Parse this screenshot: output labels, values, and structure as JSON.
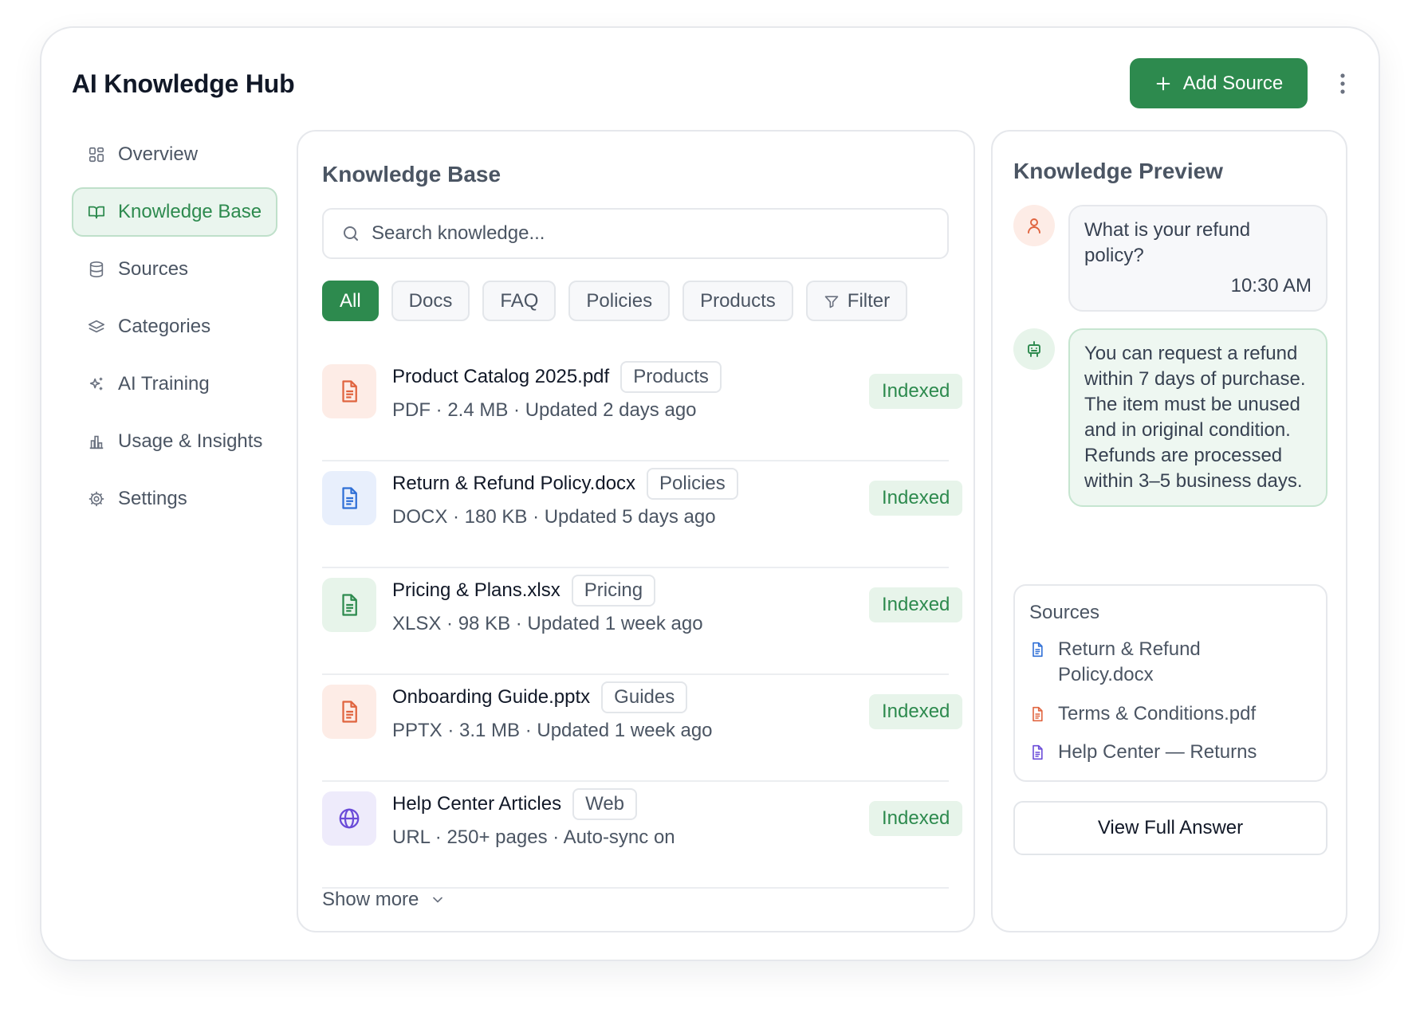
{
  "app": {
    "title": "AI Knowledge Hub"
  },
  "header": {
    "add_source_label": "Add Source",
    "accent": "#2d8a4e"
  },
  "sidebar": {
    "items": [
      {
        "label": "Overview",
        "icon": "grid-icon",
        "active": false
      },
      {
        "label": "Knowledge Base",
        "icon": "book-icon",
        "active": true
      },
      {
        "label": "Sources",
        "icon": "database-icon",
        "active": false
      },
      {
        "label": "Categories",
        "icon": "layers-icon",
        "active": false
      },
      {
        "label": "AI Training",
        "icon": "sparkles-icon",
        "active": false
      },
      {
        "label": "Usage & Insights",
        "icon": "bar-chart-icon",
        "active": false
      },
      {
        "label": "Settings",
        "icon": "gear-icon",
        "active": false
      }
    ]
  },
  "knowledge_base": {
    "title": "Knowledge Base",
    "search": {
      "placeholder": "Search knowledge...",
      "value": ""
    },
    "filters": [
      {
        "label": "All",
        "active": true
      },
      {
        "label": "Docs",
        "active": false
      },
      {
        "label": "FAQ",
        "active": false
      },
      {
        "label": "Policies",
        "active": false
      },
      {
        "label": "Products",
        "active": false
      },
      {
        "label": "Filter",
        "active": false
      }
    ],
    "items": [
      {
        "name": "Product Catalog 2025.pdf",
        "tag": "Products",
        "meta": "PDF · 2.4 MB · Updated 2 days ago",
        "status": "Indexed",
        "icon": "pdf-file-icon",
        "icon_color": "#e0643f",
        "icon_bg": "#fdece6"
      },
      {
        "name": "Return & Refund Policy.docx",
        "tag": "Policies",
        "meta": "DOCX · 180 KB · Updated 5 days ago",
        "status": "Indexed",
        "icon": "doc-file-icon",
        "icon_color": "#2f6fd6",
        "icon_bg": "#e8effc"
      },
      {
        "name": "Pricing & Plans.xlsx",
        "tag": "Pricing",
        "meta": "XLSX · 98 KB · Updated 1 week ago",
        "status": "Indexed",
        "icon": "sheet-file-icon",
        "icon_color": "#2d8a4e",
        "icon_bg": "#e7f4ea"
      },
      {
        "name": "Onboarding Guide.pptx",
        "tag": "Guides",
        "meta": "PPTX · 3.1 MB · Updated 1 week ago",
        "status": "Indexed",
        "icon": "slides-file-icon",
        "icon_color": "#e0643f",
        "icon_bg": "#fdece6"
      },
      {
        "name": "Help Center Articles",
        "tag": "Web",
        "meta": "URL · 250+ pages · Auto-sync on",
        "status": "Indexed",
        "icon": "globe-icon",
        "icon_color": "#6a4bd8",
        "icon_bg": "#eeebfb"
      }
    ],
    "show_more": "Show more"
  },
  "preview": {
    "title": "Knowledge Preview",
    "question": "What is your refund policy?",
    "question_time": "10:30 AM",
    "answer": "You can request a refund within 7 days of purchase. The item must be unused and in original condition. Refunds are processed within 3–5 business days.",
    "sources_title": "Sources",
    "sources": [
      {
        "label": "Return & Refund Policy.docx",
        "icon": "doc-file-icon",
        "color": "#2f6fd6"
      },
      {
        "label": "Terms & Conditions.pdf",
        "icon": "pdf-file-icon",
        "color": "#e0643f"
      },
      {
        "label": "Help Center — Returns",
        "icon": "article-icon",
        "color": "#6a4bd8"
      }
    ],
    "view_full_label": "View Full Answer"
  }
}
